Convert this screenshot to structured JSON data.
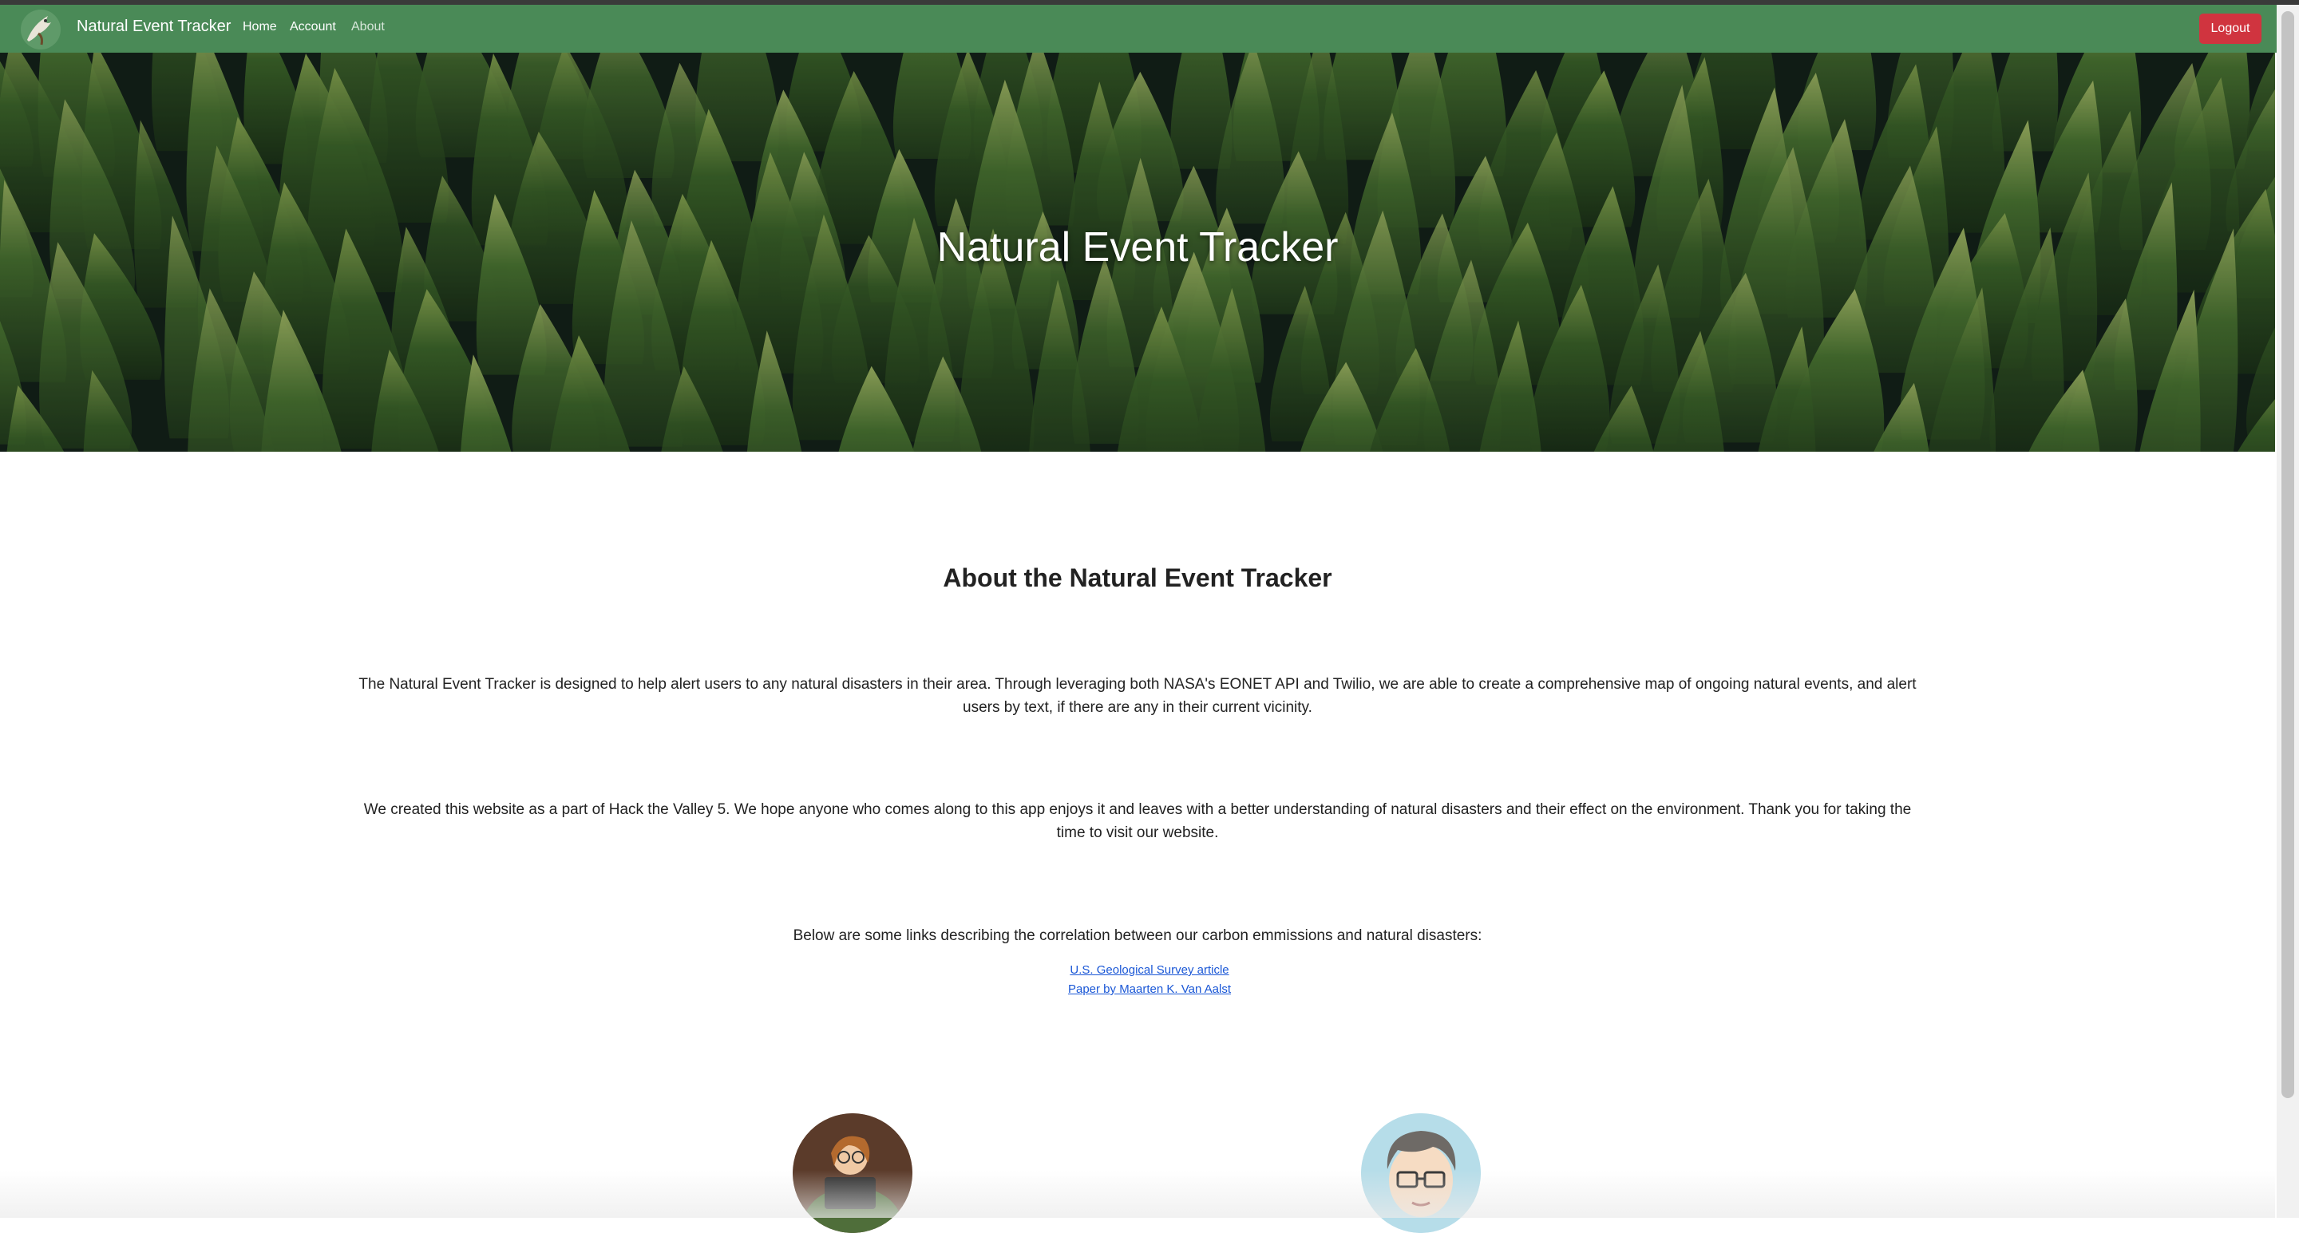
{
  "navbar": {
    "brand": "Natural Event Tracker",
    "logo_icon": "eagle-logo-icon",
    "links": [
      {
        "label": "Home"
      },
      {
        "label": "Account"
      },
      {
        "label": "About"
      }
    ],
    "logout_label": "Logout",
    "colors": {
      "bar": "#4a8a57",
      "logout": "#d0343f"
    }
  },
  "hero": {
    "title": "Natural Event Tracker",
    "image": "aerial-forest-image"
  },
  "about": {
    "title": "About the Natural Event Tracker",
    "paragraph1": "The Natural Event Tracker is designed to help alert users to any natural disasters in their area. Through leveraging both NASA's EONET API and Twilio, we are able to create a comprehensive map of ongoing natural events, and alert users by text, if there are any in their current vicinity.",
    "paragraph2": "We created this website as a part of Hack the Valley 5. We hope anyone who comes along to this app enjoys it and leaves with a better understanding of natural disasters and their effect on the environment. Thank you for taking the time to visit our website.",
    "links_intro": "Below are some links describing the correlation between our carbon emmissions and natural disasters:",
    "links": [
      {
        "label": "U.S. Geological Survey article"
      },
      {
        "label": "Paper by Maarten K. Van Aalst"
      }
    ]
  },
  "team": {
    "avatars": [
      "avatar-woman-laptop",
      "avatar-man-glasses"
    ]
  }
}
